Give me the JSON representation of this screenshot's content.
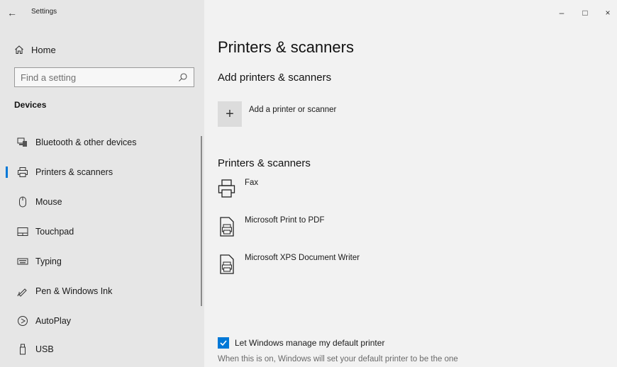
{
  "window": {
    "title": "Settings",
    "back_icon": "back-arrow-icon",
    "controls": {
      "minimize": "–",
      "maximize": "□",
      "close": "×"
    }
  },
  "sidebar": {
    "home_label": "Home",
    "search": {
      "placeholder": "Find a setting",
      "icon": "search-icon"
    },
    "section_label": "Devices",
    "items": [
      {
        "label": "Bluetooth & other devices",
        "icon": "bluetooth-devices-icon",
        "active": false
      },
      {
        "label": "Printers & scanners",
        "icon": "printer-icon",
        "active": true
      },
      {
        "label": "Mouse",
        "icon": "mouse-icon",
        "active": false
      },
      {
        "label": "Touchpad",
        "icon": "touchpad-icon",
        "active": false
      },
      {
        "label": "Typing",
        "icon": "keyboard-icon",
        "active": false
      },
      {
        "label": "Pen & Windows Ink",
        "icon": "pen-icon",
        "active": false
      },
      {
        "label": "AutoPlay",
        "icon": "autoplay-icon",
        "active": false
      },
      {
        "label": "USB",
        "icon": "usb-icon",
        "active": false
      }
    ]
  },
  "main": {
    "page_title": "Printers & scanners",
    "add_section_title": "Add printers & scanners",
    "add_button_label": "Add a printer or scanner",
    "list_section_title": "Printers & scanners",
    "printers": [
      {
        "name": "Fax",
        "icon": "printer-icon"
      },
      {
        "name": "Microsoft Print to PDF",
        "icon": "printer-document-icon"
      },
      {
        "name": "Microsoft XPS Document Writer",
        "icon": "printer-document-icon"
      }
    ],
    "default_printer": {
      "checkbox_label": "Let Windows manage my default printer",
      "checked": true,
      "helper_text": "When this is on, Windows will set your default printer to be the one"
    }
  },
  "colors": {
    "accent": "#0078d7",
    "sidebar_bg": "#e6e6e6",
    "main_bg": "#f2f2f2"
  }
}
